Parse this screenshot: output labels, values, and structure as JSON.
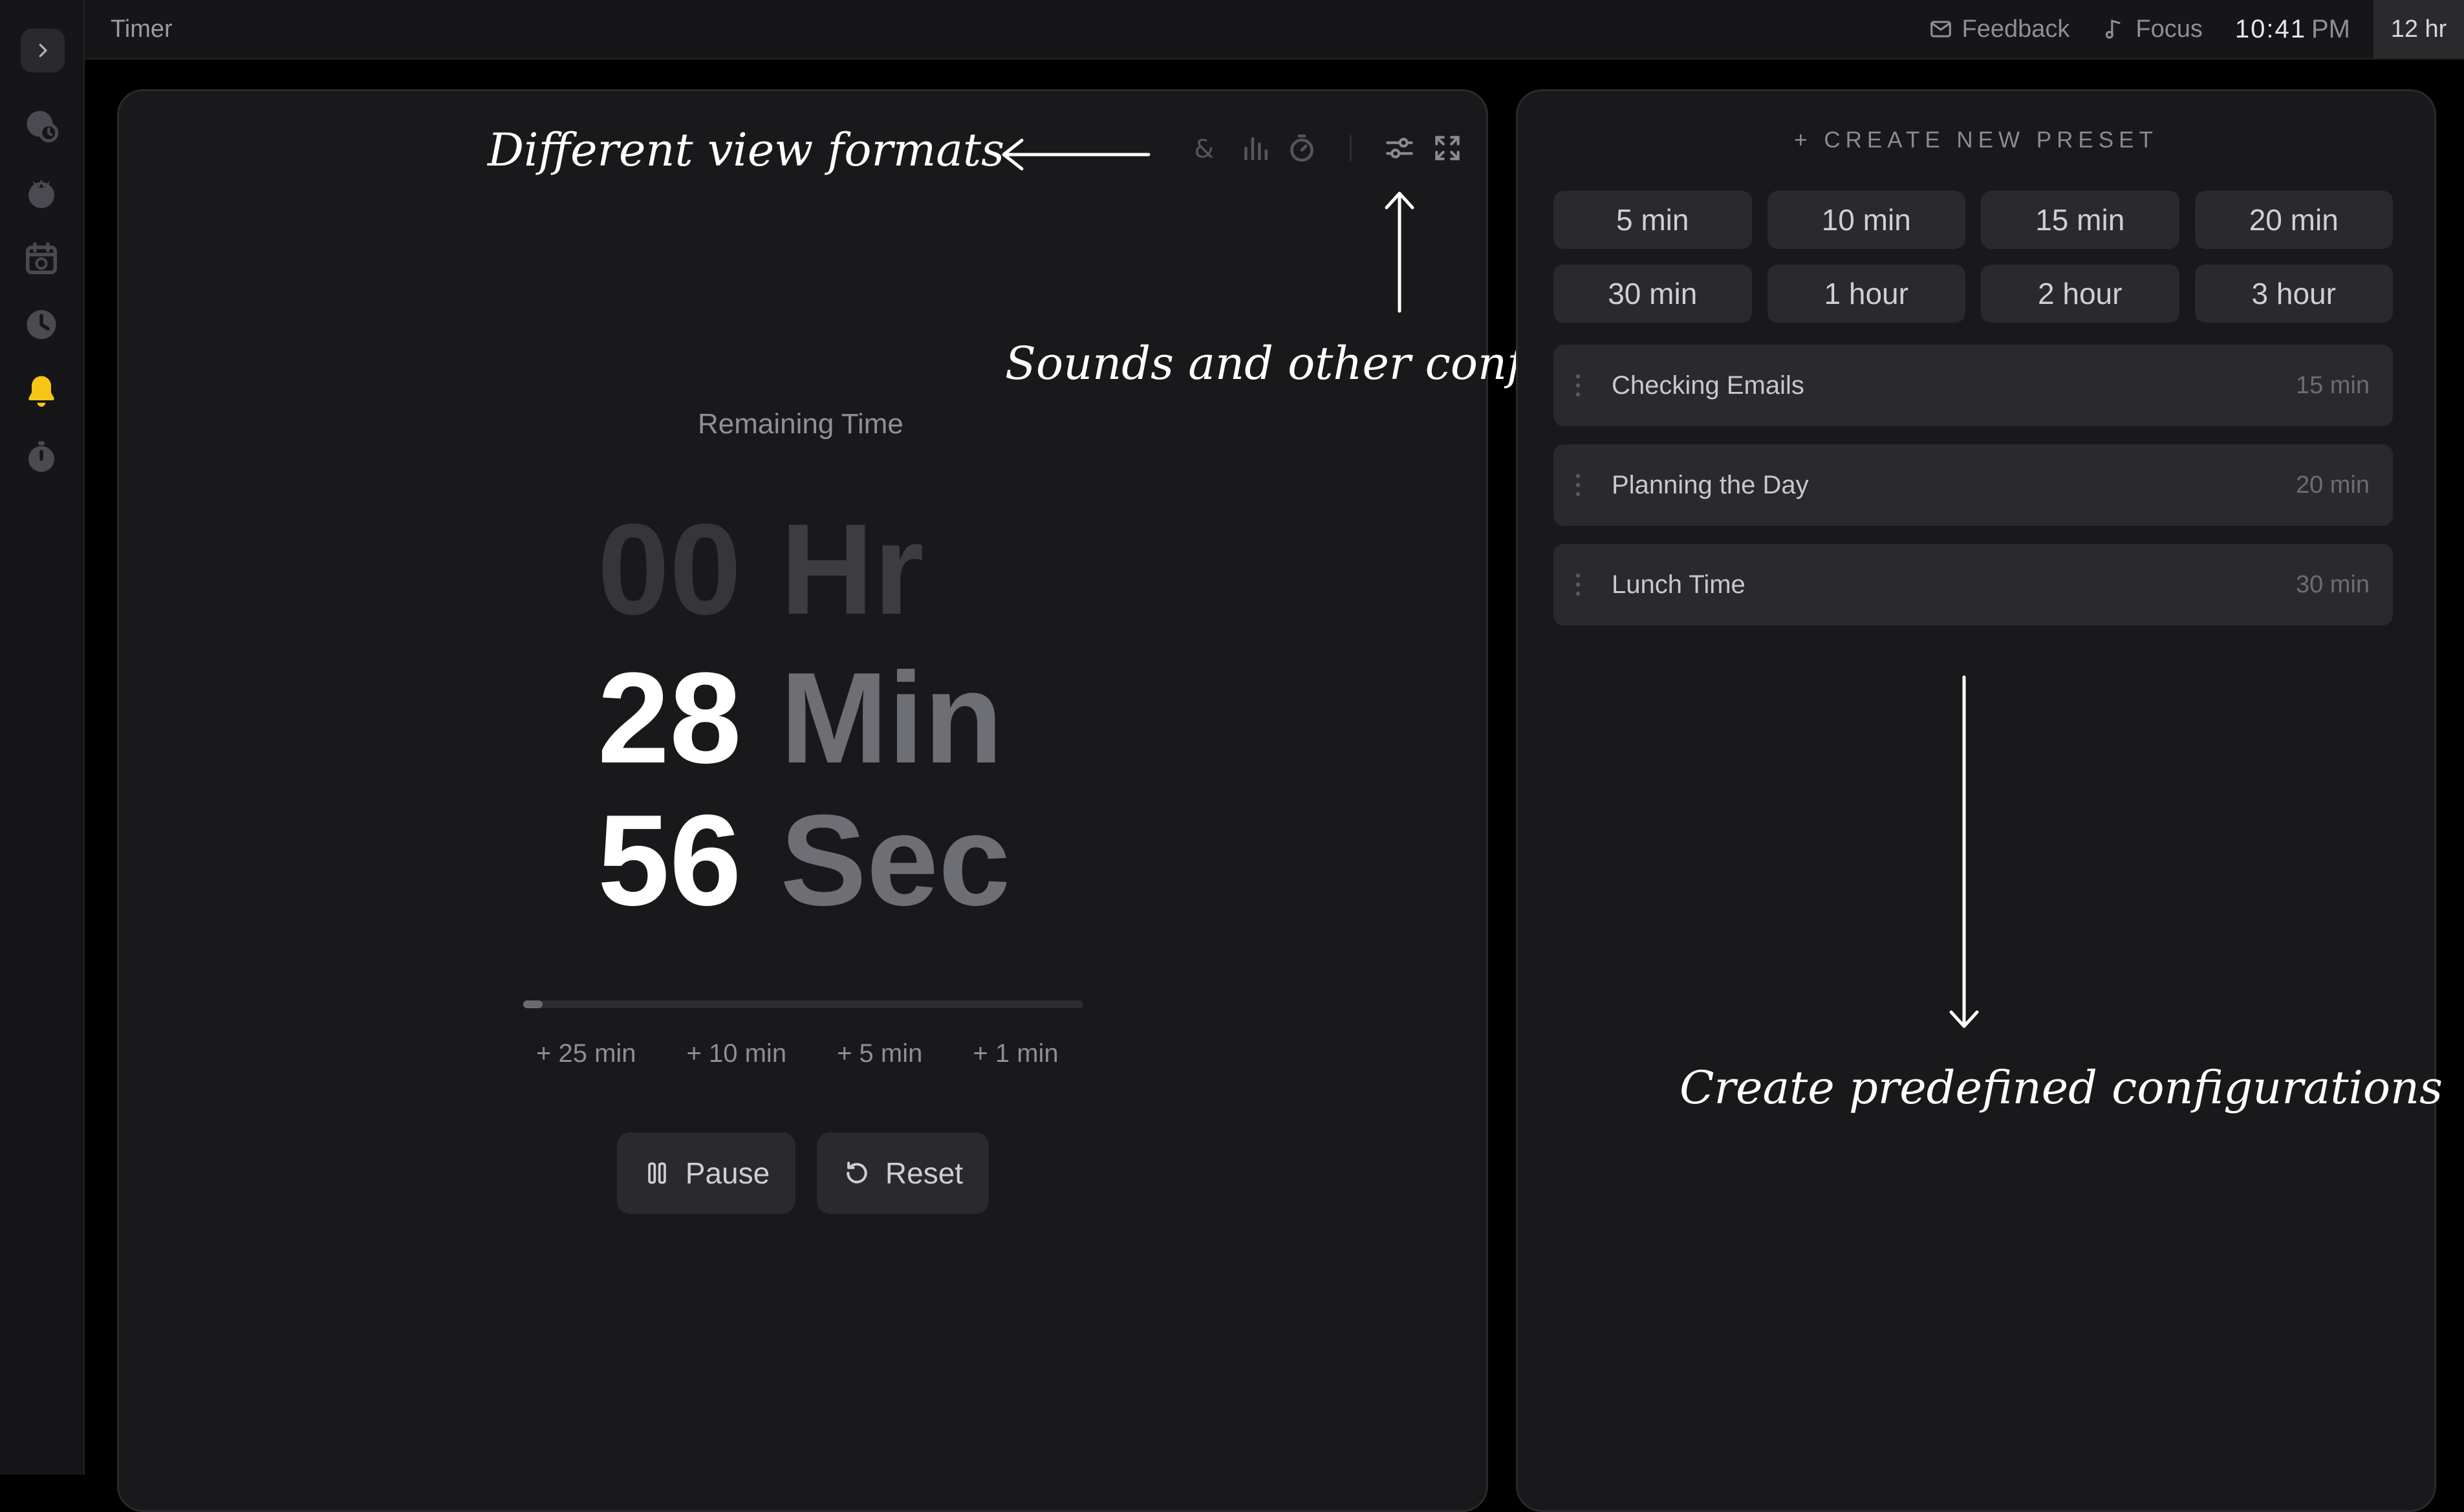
{
  "app": {
    "title": "Timer"
  },
  "header": {
    "feedback_label": "Feedback",
    "focus_label": "Focus",
    "time": "10:41",
    "ampm": "PM",
    "format_toggle": "12 hr"
  },
  "sidebar": {
    "items": [
      {
        "icon": "world-clock-icon"
      },
      {
        "icon": "tomato-icon"
      },
      {
        "icon": "calendar-icon"
      },
      {
        "icon": "clock-icon"
      },
      {
        "icon": "bell-icon",
        "active": true
      },
      {
        "icon": "stopwatch-icon"
      }
    ]
  },
  "annotations": {
    "view_formats": "Different view formats",
    "sounds_config": "Sounds and other config",
    "predefined": "Create predefined configurations"
  },
  "timer": {
    "remaining_label": "Remaining Time",
    "hours": "00",
    "hours_unit": "Hr",
    "minutes": "28",
    "minutes_unit": "Min",
    "seconds": "56",
    "seconds_unit": "Sec",
    "progress_fraction": 0.035,
    "add_buttons": [
      "+ 25 min",
      "+ 10 min",
      "+ 5 min",
      "+ 1 min"
    ],
    "pause_label": "Pause",
    "reset_label": "Reset"
  },
  "presets": {
    "create_label": "+ CREATE NEW PRESET",
    "quick": [
      "5 min",
      "10 min",
      "15 min",
      "20 min",
      "30 min",
      "1 hour",
      "2 hour",
      "3 hour"
    ],
    "saved": [
      {
        "label": "Checking Emails",
        "duration": "15 min"
      },
      {
        "label": "Planning the Day",
        "duration": "20 min"
      },
      {
        "label": "Lunch Time",
        "duration": "30 min"
      }
    ]
  },
  "colors": {
    "accent_bell": "#f5c518",
    "background": "#000000",
    "panel": "#19191b",
    "button": "#2a2a2d"
  }
}
